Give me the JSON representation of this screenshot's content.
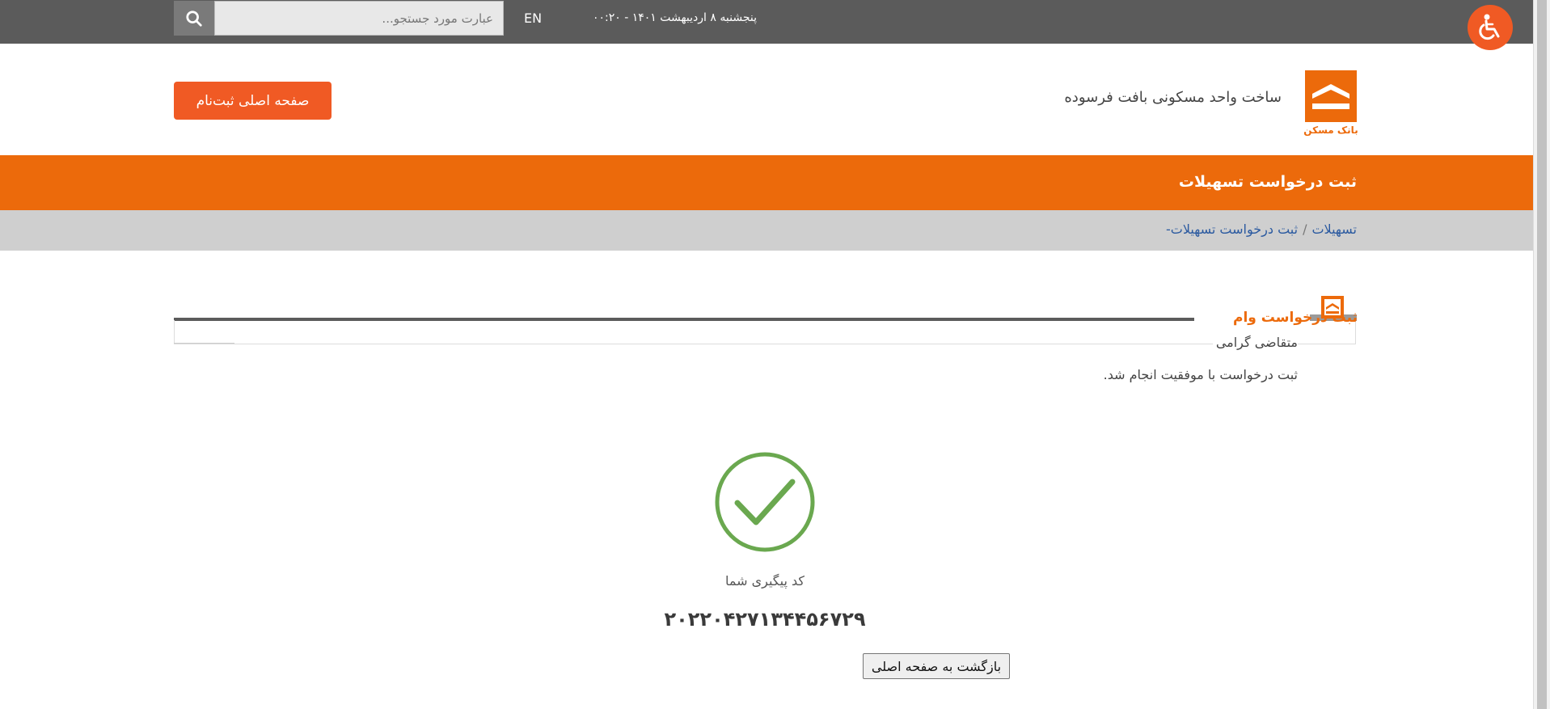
{
  "topbar": {
    "search_placeholder": "عبارت مورد جستجو...",
    "lang_label": "EN",
    "datetime": "پنجشنبه ۸ اردیبهشت ۱۴۰۱ - ۰۰:۲۰"
  },
  "header": {
    "site_title": "ساخت واحد مسکونی بافت فرسوده",
    "logo_text": "بانک مسکن",
    "home_registration_button": "صفحه اصلی ثبت‌نام"
  },
  "page": {
    "title": "ثبت درخواست تسهیلات",
    "breadcrumb": {
      "root": "تسهیلات",
      "separator": "/",
      "current": "ثبت درخواست تسهیلات-"
    }
  },
  "section": {
    "title": "ثبت درخواست وام",
    "greeting": "متقاضی گرامی",
    "message": "ثبت درخواست با موفقیت انجام شد."
  },
  "result": {
    "tracking_label": "کد پیگیری شما",
    "tracking_code": "۲۰۲۲۰۴۲۷۱۳۴۴۵۶۷۲۹",
    "back_button": "بازگشت به صفحه اصلی"
  },
  "colors": {
    "brand_orange": "#ec6a0b",
    "accent_orange": "#f05a24",
    "topbar_gray": "#5b5b5b",
    "success_green": "#6aa84f"
  },
  "icons": [
    "search-icon",
    "accessibility-icon",
    "bank-maskan-logo",
    "section-logo-icon",
    "success-check-icon"
  ]
}
